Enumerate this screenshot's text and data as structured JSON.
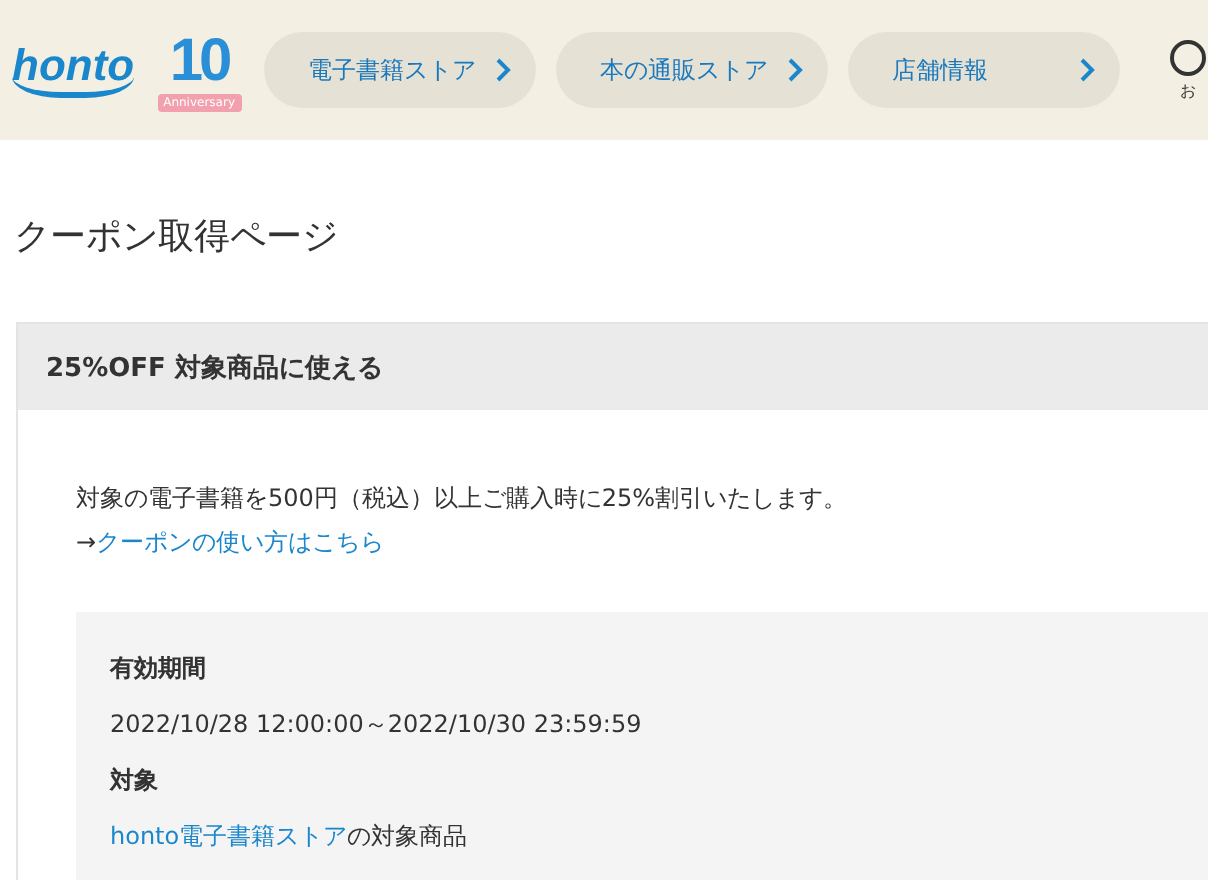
{
  "header": {
    "logo": "honto",
    "badge": {
      "number": "10",
      "ribbon": "Anniversary"
    },
    "nav": [
      {
        "label": "電子書籍ストア"
      },
      {
        "label": "本の通販ストア"
      },
      {
        "label": "店舗情報"
      }
    ],
    "corner_label": "お"
  },
  "page_title": "クーポン取得ページ",
  "coupon": {
    "title": "25%OFF 対象商品に使える",
    "description": "対象の電子書籍を500円（税込）以上ご購入時に25%割引いたします。",
    "help_arrow": "→",
    "help_link": "クーポンの使い方はこちら",
    "details": [
      {
        "kind": "text",
        "label": "有効期間",
        "value": "2022/10/28 12:00:00～2022/10/30 23:59:59"
      },
      {
        "kind": "link",
        "label": "対象",
        "link": "honto電子書籍ストア",
        "suffix": "の対象商品"
      }
    ]
  }
}
